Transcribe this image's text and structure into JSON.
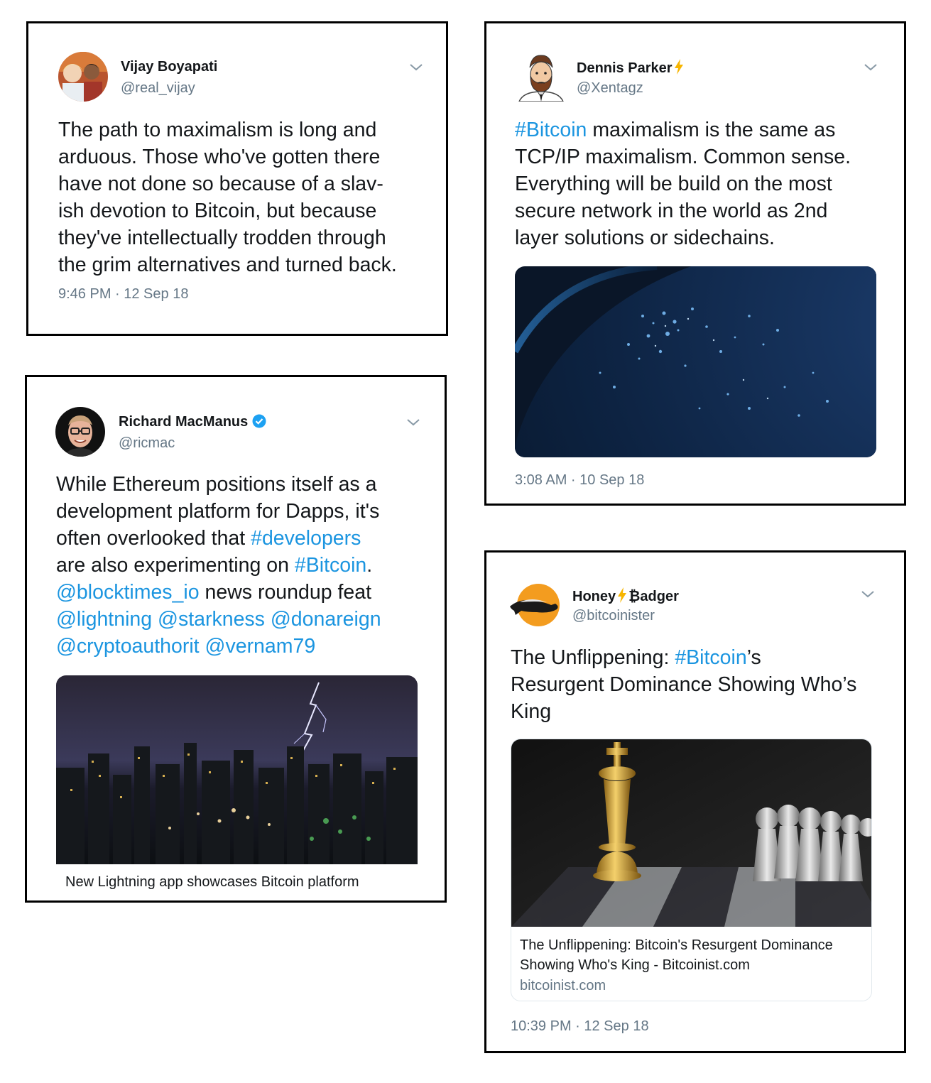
{
  "tweets": [
    {
      "name": "Vijay Boyapati",
      "handle": "@real_vijay",
      "lines": [
        "The path to maximalism is long and",
        "arduous. Those who've gotten there",
        "have not done so because of a slav-",
        "ish devotion to Bitcoin, but because",
        "they've intellectually trodden through",
        "the grim alternatives and turned back."
      ],
      "timestamp": "9:46 PM · 12 Sep 18",
      "avatar_icon": "person-photo-icon"
    },
    {
      "name": "Dennis Parker",
      "handle": "@Xentagz",
      "text": {
        "hashtag": "#Bitcoin",
        "line1_rest": " maximalism is the same as",
        "line2": "TCP/IP maximalism. Common sense.",
        "line3": "Everything will be build on the most",
        "line4": "secure network in the world as 2nd",
        "line5": "layer solutions or sidechains."
      },
      "timestamp": "3:08 AM · 10 Sep 18",
      "media": "earth-night-lights-image",
      "avatar_icon": "bearded-man-cartoon-icon"
    },
    {
      "name": "Richard MacManus",
      "handle": "@ricmac",
      "text": {
        "line1": "While Ethereum positions itself as a",
        "line2": "development platform for Dapps, it's",
        "line3_pre": "often overlooked that ",
        "line3_link": "#developers",
        "line4_pre": "are also experimenting on ",
        "line4_link": "#Bitcoin",
        "line4_post": ".",
        "line5_link": "@blocktimes_io",
        "line5_post": " news roundup feat",
        "line6_link1": "@lightning",
        "line6_link2": "@starkness",
        "line6_link3": "@donareign",
        "line7_link1": "@cryptoauthorit",
        "line7_link2": "@vernam79"
      },
      "media_caption": "New Lightning app showcases Bitcoin platform",
      "media": "lightning-city-night-image",
      "avatar_icon": "man-glasses-photo-icon"
    },
    {
      "name_part1": "Honey",
      "name_part2": "₿adger",
      "handle": "@bitcoinister",
      "text": {
        "line1_pre": "The Unflippening: ",
        "line1_link": "#Bitcoin",
        "line1_post": "’s",
        "line2": "Resurgent Dominance Showing Who’s",
        "line3": "King"
      },
      "card": {
        "title_line1": "The Unflippening: Bitcoin's Resurgent Dominance",
        "title_line2": "Showing Who's King - Bitcoinist.com",
        "domain": "bitcoinist.com"
      },
      "timestamp": "10:39 PM · 12 Sep 18",
      "media": "chess-king-pawns-image",
      "avatar_icon": "honey-badger-logo-icon"
    }
  ],
  "colors": {
    "link": "#1b95e0",
    "secondary": "#657786",
    "text": "#14171a",
    "verified": "#1da1f2",
    "bolt": "#f7b500"
  }
}
